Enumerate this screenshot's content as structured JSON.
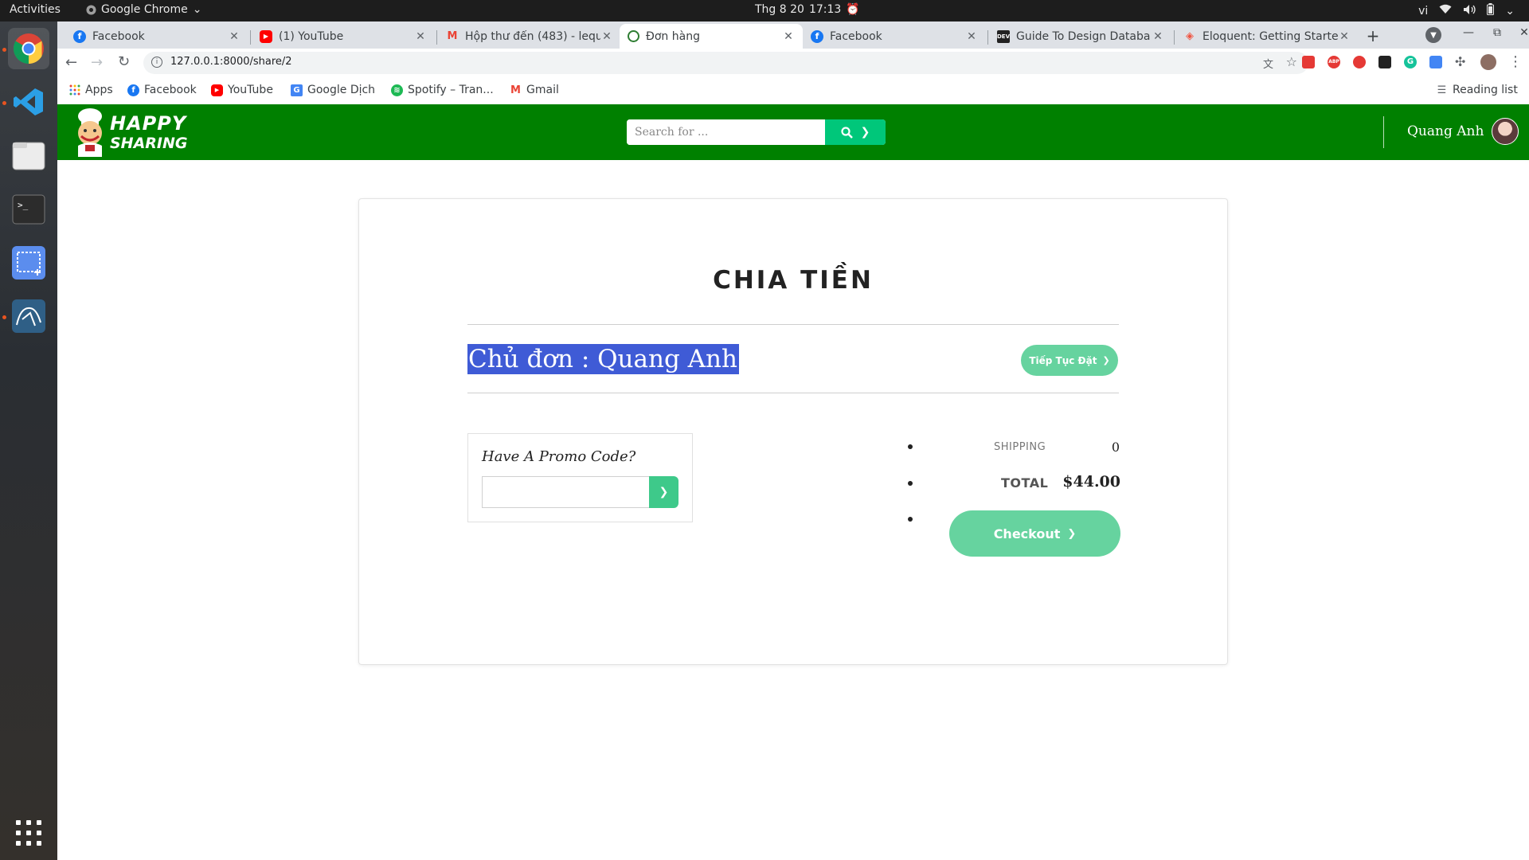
{
  "os": {
    "activities": "Activities",
    "app_name": "Google Chrome",
    "date": "Thg 8 20",
    "time": "17:13",
    "language": "vi"
  },
  "browser": {
    "tabs": [
      {
        "title": "Facebook",
        "icon": "facebook-icon"
      },
      {
        "title": "(1) YouTube",
        "icon": "youtube-icon"
      },
      {
        "title": "Hộp thư đến (483) - lequ",
        "icon": "gmail-icon"
      },
      {
        "title": "Đơn hàng",
        "icon": "site-icon",
        "active": true
      },
      {
        "title": "Facebook",
        "icon": "facebook-icon"
      },
      {
        "title": "Guide To Design Databa",
        "icon": "devto-icon"
      },
      {
        "title": "Eloquent: Getting Starte",
        "icon": "laravel-icon"
      }
    ],
    "url": "127.0.0.1:8000/share/2",
    "bookmarks": [
      {
        "label": "Apps",
        "icon": "apps-grid-icon"
      },
      {
        "label": "Facebook",
        "icon": "facebook-icon"
      },
      {
        "label": "YouTube",
        "icon": "youtube-icon"
      },
      {
        "label": "Google Dịch",
        "icon": "google-translate-icon"
      },
      {
        "label": "Spotify – Tran...",
        "icon": "spotify-icon"
      },
      {
        "label": "Gmail",
        "icon": "gmail-icon"
      }
    ],
    "reading_list": "Reading list"
  },
  "site": {
    "logo_line1": "HAPPY",
    "logo_line2": "SHARING",
    "search_placeholder": "Search for ...",
    "search_chevron": "❯",
    "user_name": "Quang Anh"
  },
  "main": {
    "title": "CHIA TIỀN",
    "owner_text": "Chủ đơn : Quang Anh",
    "continue_label": "Tiếp Tục Đặt",
    "promo_label": "Have A Promo Code?",
    "promo_value": "",
    "promo_button": "❯",
    "shipping_label": "SHIPPING",
    "shipping_value": "0",
    "total_label": "TOTAL",
    "total_value": "$44.00",
    "checkout_label": "Checkout"
  },
  "colors": {
    "header_green": "#008000",
    "accent_green": "#00c77a",
    "pill_green": "#66d39f",
    "selection": "#3f5bd6"
  }
}
